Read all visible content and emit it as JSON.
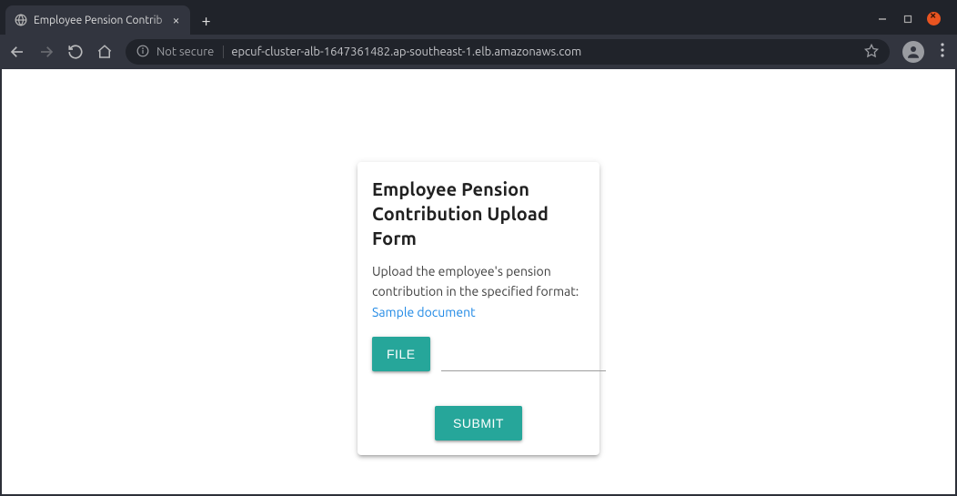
{
  "browser": {
    "tab_title": "Employee Pension Contrib",
    "security_label": "Not secure",
    "url": "epcuf-cluster-alb-1647361482.ap-southeast-1.elb.amazonaws.com"
  },
  "form": {
    "title": "Employee Pension Contribution Upload Form",
    "subtitle_prefix": "Upload the employee's pension contribution in the specified format: ",
    "sample_link_text": "Sample document",
    "file_button_label": "File",
    "file_input_value": "",
    "submit_label": "Submit"
  },
  "colors": {
    "accent": "#26a69a",
    "link": "#1e88e5"
  }
}
